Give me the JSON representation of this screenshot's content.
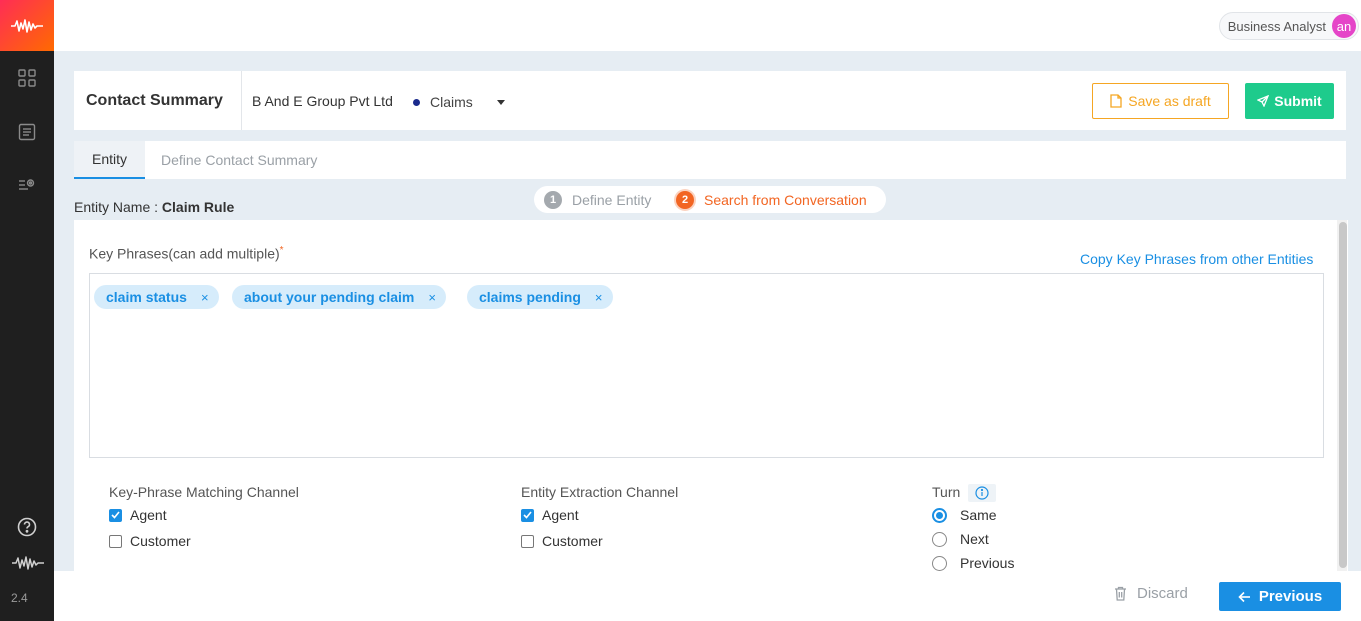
{
  "sidebar": {
    "logo_icon": "waveform-logo-icon",
    "nav_icons": [
      "grid-icon",
      "document-list-icon",
      "settings-list-icon"
    ],
    "help_icon": "help-circle-icon",
    "brand_icon": "waveform-icon",
    "version": "2.4"
  },
  "topbar": {
    "role": "Business Analyst",
    "avatar_initials": "an"
  },
  "header": {
    "title": "Contact Summary",
    "company": "B And E Group Pvt Ltd",
    "category": "Claims",
    "save_draft_label": "Save as draft",
    "submit_label": "Submit"
  },
  "tabs": [
    {
      "label": "Entity",
      "active": true
    },
    {
      "label": "Define Contact Summary",
      "active": false
    }
  ],
  "entity": {
    "name_label": "Entity Name :",
    "name_value": "Claim Rule"
  },
  "stepper": [
    {
      "number": "1",
      "label": "Define Entity",
      "active": false
    },
    {
      "number": "2",
      "label": "Search from Conversation",
      "active": true
    }
  ],
  "key_phrases": {
    "label": "Key Phrases(can add multiple)",
    "required_mark": "*",
    "copy_link": "Copy Key Phrases from other Entities",
    "chips": [
      "claim status",
      "about your pending claim",
      "claims pending"
    ],
    "remove_symbol": "×"
  },
  "matching_channel": {
    "title": "Key-Phrase Matching Channel",
    "options": [
      {
        "label": "Agent",
        "checked": true
      },
      {
        "label": "Customer",
        "checked": false
      }
    ]
  },
  "extraction_channel": {
    "title": "Entity Extraction Channel",
    "options": [
      {
        "label": "Agent",
        "checked": true
      },
      {
        "label": "Customer",
        "checked": false
      }
    ]
  },
  "turn": {
    "title": "Turn",
    "options": [
      {
        "label": "Same",
        "checked": true
      },
      {
        "label": "Next",
        "checked": false
      },
      {
        "label": "Previous",
        "checked": false
      }
    ]
  },
  "footer": {
    "discard_label": "Discard",
    "previous_label": "Previous"
  },
  "colors": {
    "accent": "#1a8fe3",
    "submit": "#1ecb8c",
    "draft": "#f5a623",
    "step_active": "#f26522",
    "avatar": "#e545c8"
  }
}
